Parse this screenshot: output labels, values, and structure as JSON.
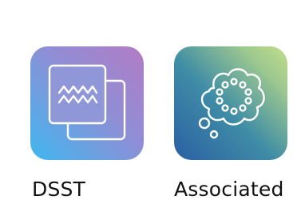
{
  "apps": [
    {
      "label": "DSST",
      "icon": "overlapping-squares-wave-icon"
    },
    {
      "label": "Associated",
      "icon": "thought-bubble-dots-icon"
    }
  ],
  "colors": {
    "dsst_gradient": [
      "#3fb7ee",
      "#8f8ed6",
      "#b27cc4"
    ],
    "associated_gradient": [
      "#2a5fa3",
      "#3f8da6",
      "#9ec98f",
      "#c2dd8a"
    ],
    "label_text": "#111111"
  }
}
